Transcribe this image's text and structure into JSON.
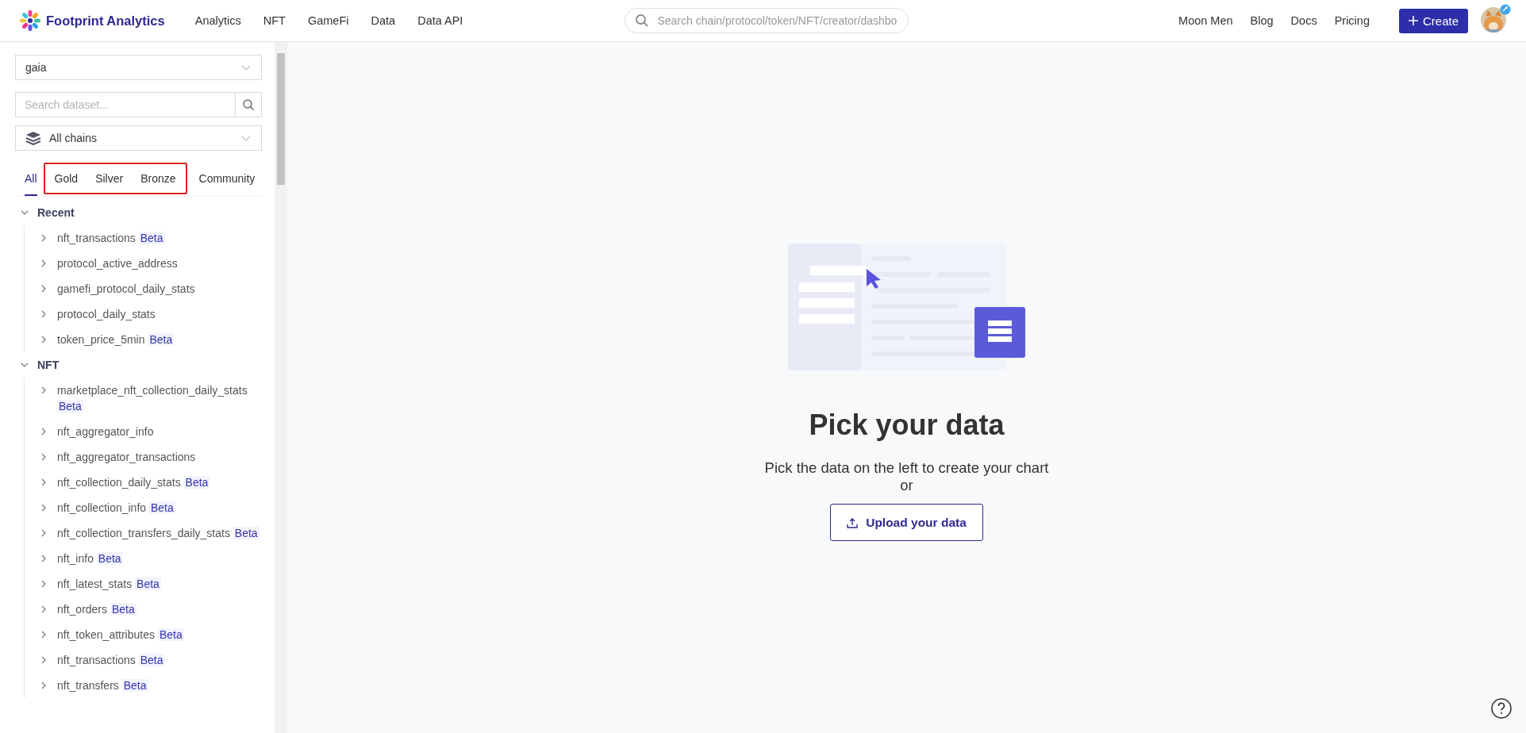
{
  "header": {
    "brand": "Footprint Analytics",
    "nav": [
      "Analytics",
      "NFT",
      "GameFi",
      "Data",
      "Data API"
    ],
    "search": {
      "placeholder": "Search chain/protocol/token/NFT/creator/dashbo"
    },
    "links": [
      "Moon Men",
      "Blog",
      "Docs",
      "Pricing"
    ],
    "create_button": "Create"
  },
  "sidebar": {
    "project_select": {
      "value": "gaia"
    },
    "dataset_search": {
      "placeholder": "Search dataset..."
    },
    "chain_select": {
      "value": "All chains"
    },
    "tabs": [
      {
        "label": "All",
        "selected": true,
        "highlighted": false
      },
      {
        "label": "Gold",
        "selected": false,
        "highlighted": true
      },
      {
        "label": "Silver",
        "selected": false,
        "highlighted": true
      },
      {
        "label": "Bronze",
        "selected": false,
        "highlighted": true
      },
      {
        "label": "Community",
        "selected": false,
        "highlighted": false
      }
    ],
    "tree": [
      {
        "label": "Recent",
        "expanded": true,
        "children": [
          {
            "label": "nft_transactions",
            "badge": "Beta",
            "expanded": false
          },
          {
            "label": "protocol_active_address",
            "expanded": false
          },
          {
            "label": "gamefi_protocol_daily_stats",
            "expanded": false
          },
          {
            "label": "protocol_daily_stats",
            "expanded": false
          },
          {
            "label": "token_price_5min",
            "badge": "Beta",
            "expanded": false
          }
        ]
      },
      {
        "label": "NFT",
        "expanded": true,
        "children": [
          {
            "label": "marketplace_nft_collection_daily_stats",
            "badge": "Beta",
            "expanded": false
          },
          {
            "label": "nft_aggregator_info",
            "expanded": false
          },
          {
            "label": "nft_aggregator_transactions",
            "expanded": false
          },
          {
            "label": "nft_collection_daily_stats",
            "badge": "Beta",
            "expanded": false
          },
          {
            "label": "nft_collection_info",
            "badge": "Beta",
            "expanded": false
          },
          {
            "label": "nft_collection_transfers_daily_stats",
            "badge": "Beta",
            "expanded": false
          },
          {
            "label": "nft_info",
            "badge": "Beta",
            "expanded": false
          },
          {
            "label": "nft_latest_stats",
            "badge": "Beta",
            "expanded": false
          },
          {
            "label": "nft_orders",
            "badge": "Beta",
            "expanded": false
          },
          {
            "label": "nft_token_attributes",
            "badge": "Beta",
            "expanded": false
          },
          {
            "label": "nft_transactions",
            "badge": "Beta",
            "expanded": false
          },
          {
            "label": "nft_transfers",
            "badge": "Beta",
            "expanded": false
          }
        ]
      }
    ]
  },
  "main": {
    "title": "Pick your data",
    "subtitle": "Pick the data on the left to create your chart",
    "or": "or",
    "upload_button": "Upload your data"
  }
}
